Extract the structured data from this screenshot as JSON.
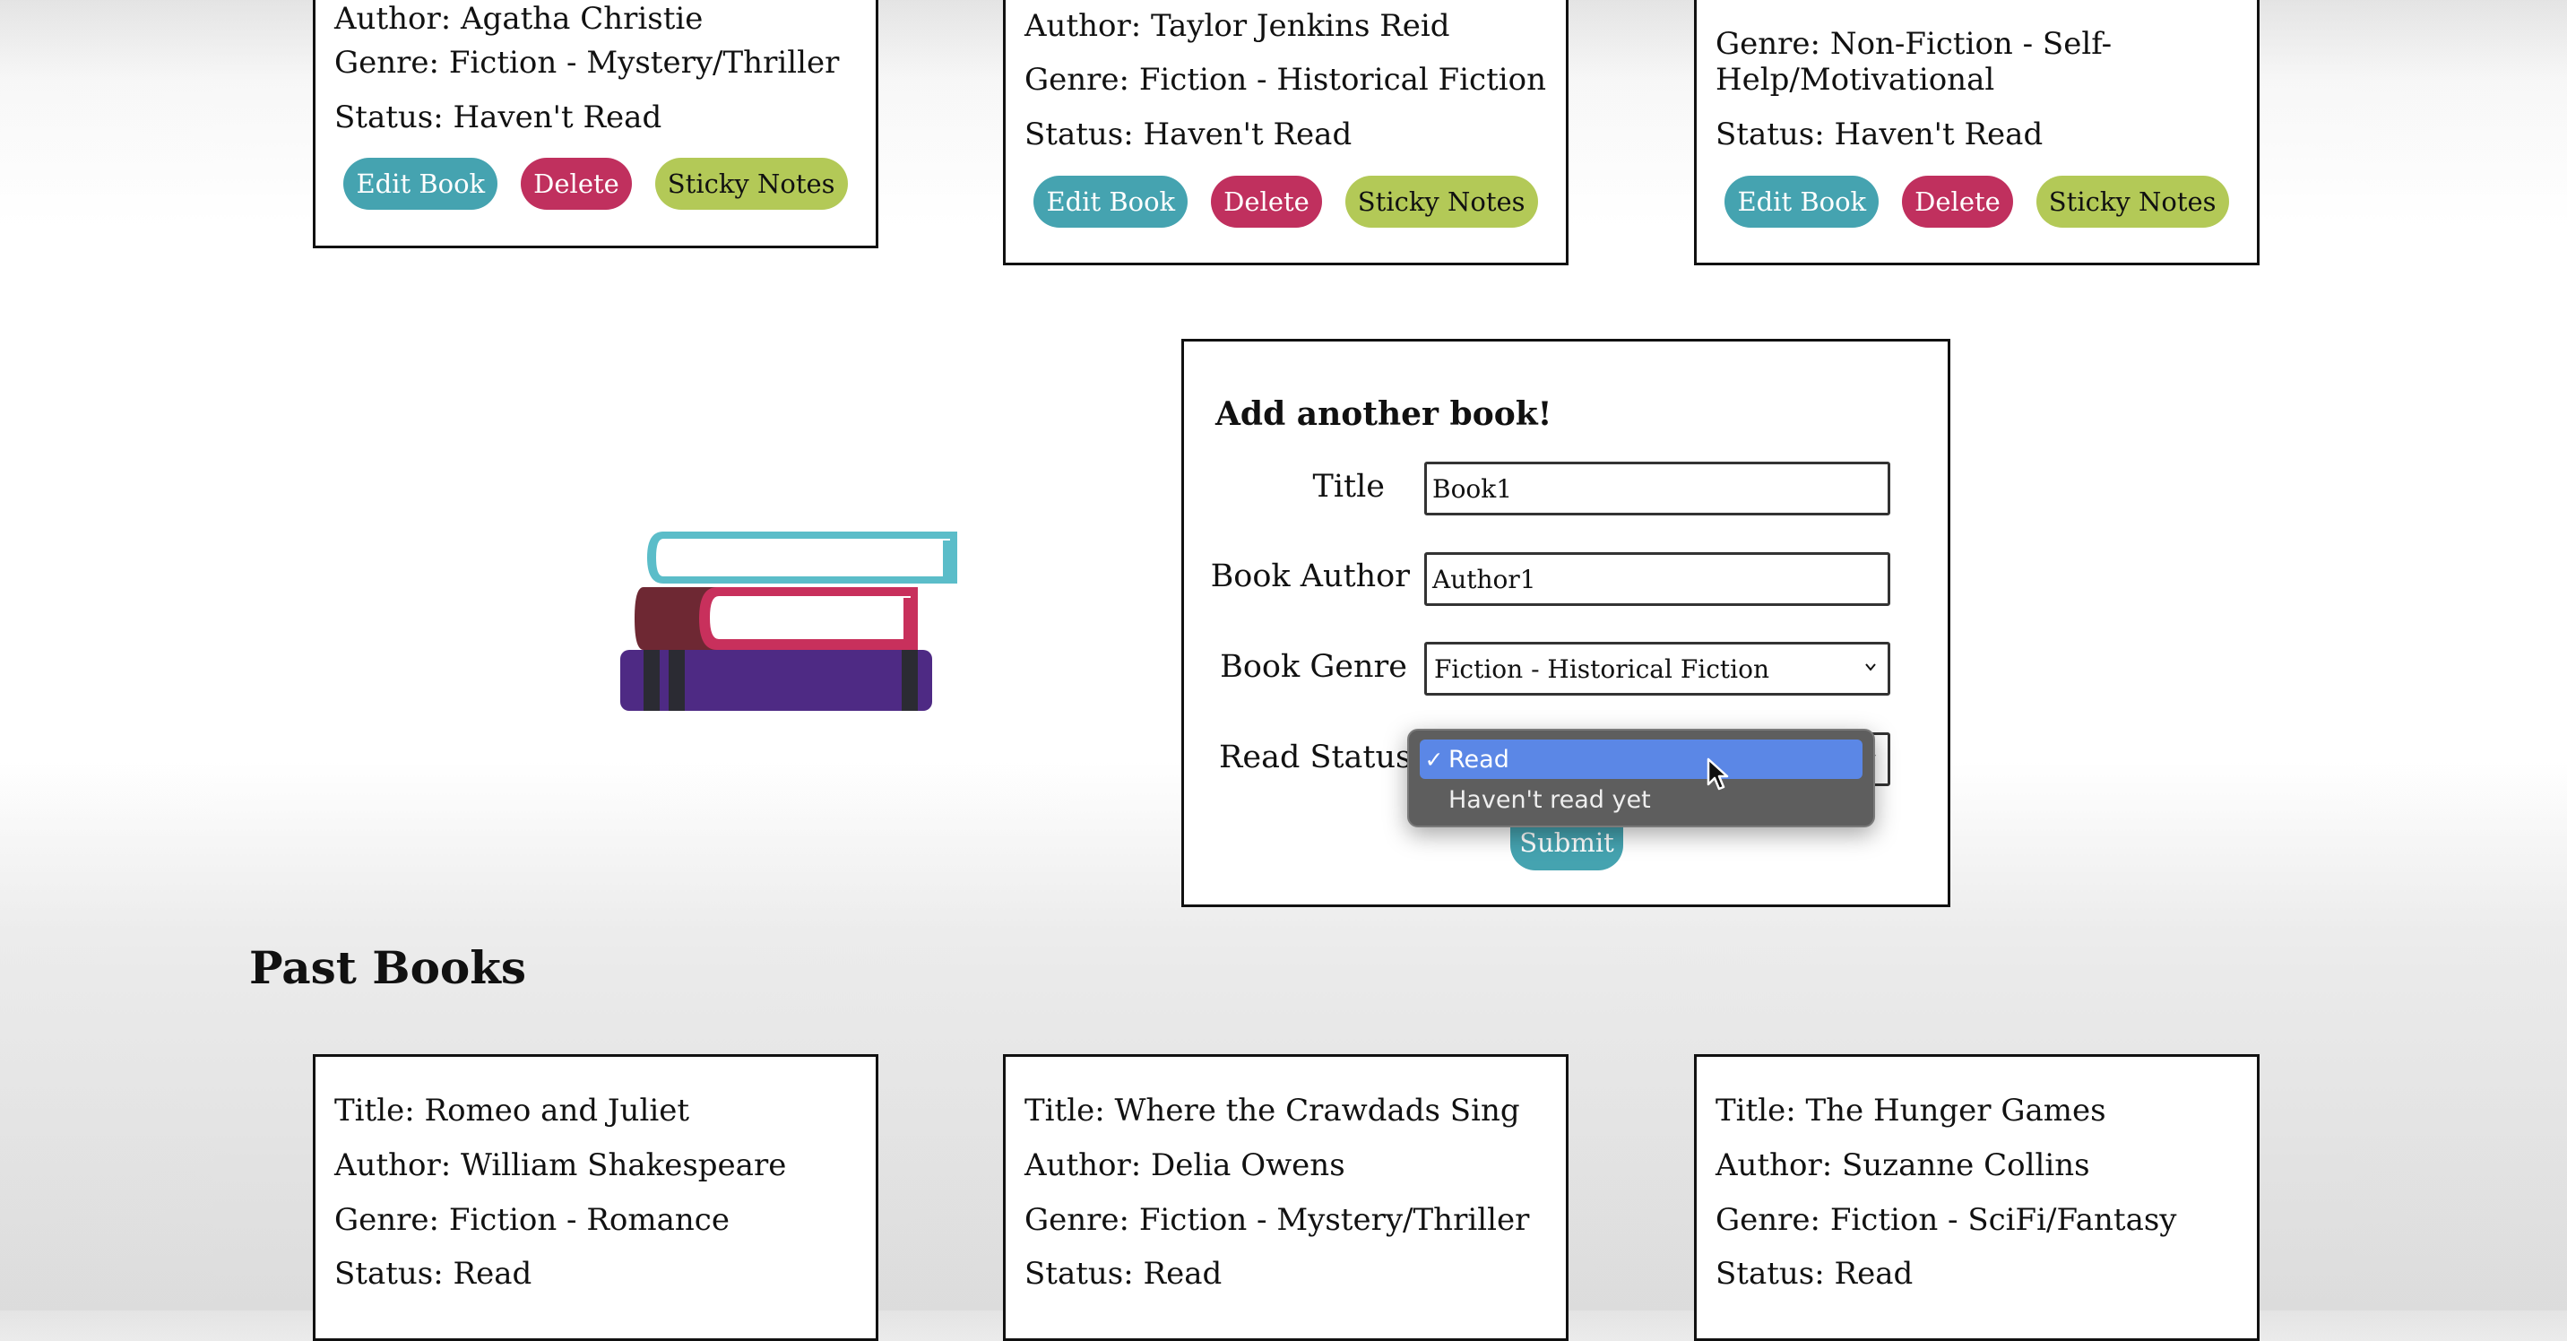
{
  "top_books": [
    {
      "author": "Author: Agatha Christie",
      "genre": "Genre: Fiction - Mystery/Thriller",
      "status": "Status: Haven't Read"
    },
    {
      "author": "Author: Taylor Jenkins Reid",
      "genre": "Genre: Fiction - Historical Fiction",
      "status": "Status: Haven't Read"
    },
    {
      "genre_line1": "Genre: Non-Fiction - Self-",
      "genre_line2": "Help/Motivational",
      "status": "Status: Haven't Read"
    }
  ],
  "buttons": {
    "edit": "Edit Book",
    "delete": "Delete",
    "sticky": "Sticky Notes"
  },
  "colors": {
    "edit": "#45a3b0",
    "delete": "#c0305e",
    "sticky": "#b3c957",
    "book_top": "#5bbdc9",
    "book_mid": "#c8305c",
    "book_bottom": "#4e2a84"
  },
  "illustration": {
    "icon": "stacked-books-icon"
  },
  "form": {
    "title": "Add another book!",
    "labels": {
      "title": "Title",
      "author": "Book Author",
      "genre": "Book Genre",
      "status": "Read Status"
    },
    "values": {
      "title": "Book1",
      "author": "Author1",
      "genre": "Fiction - Historical Fiction"
    },
    "status_options": [
      "Read",
      "Haven't read yet"
    ],
    "check": "✓",
    "submit": "Submit"
  },
  "past_heading": "Past Books",
  "past_books": [
    {
      "title": "Title: Romeo and Juliet",
      "author": "Author: William Shakespeare",
      "genre": "Genre: Fiction - Romance",
      "status": "Status: Read"
    },
    {
      "title": "Title: Where the Crawdads Sing",
      "author": "Author: Delia Owens",
      "genre": "Genre: Fiction - Mystery/Thriller",
      "status": "Status: Read"
    },
    {
      "title": "Title: The Hunger Games",
      "author": "Author: Suzanne Collins",
      "genre": "Genre: Fiction - SciFi/Fantasy",
      "status": "Status: Read"
    }
  ]
}
